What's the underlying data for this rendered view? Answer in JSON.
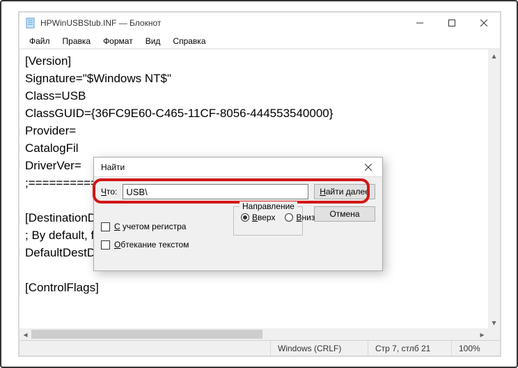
{
  "window": {
    "title": "HPWinUSBStub.INF — Блокнот"
  },
  "menu": {
    "file": "Файл",
    "edit": "Правка",
    "format": "Формат",
    "view": "Вид",
    "help": "Справка"
  },
  "editor": {
    "content": "[Version]\nSignature=\"$Windows NT$\"\nClass=USB\nClassGUID={36FC9E60-C465-11CF-8056-444553540000}\nProvider=\nCatalogFil\nDriverVer=\n;========================                   =================\n\n[DestinationDirs]\n; By default, files will be copied to \\windows\\system.\nDefaultDestDir=11\n\n[ControlFlags]"
  },
  "find": {
    "title": "Найти",
    "what_label_u": "Ч",
    "what_label_rest": "то:",
    "value": "USB\\",
    "find_next_u": "Н",
    "find_next_rest": "айти далее",
    "cancel": "Отмена",
    "direction": "Направление",
    "up_u": "В",
    "up_rest": "верх",
    "down_u": "В",
    "down_rest": "низ",
    "case_u": "С",
    "case_rest": " учетом регистра",
    "wrap_u": "О",
    "wrap_rest": "бтекание текстом"
  },
  "status": {
    "encoding": "Windows (CRLF)",
    "pos": "Стр 7, стлб 21",
    "zoom": "100%"
  }
}
